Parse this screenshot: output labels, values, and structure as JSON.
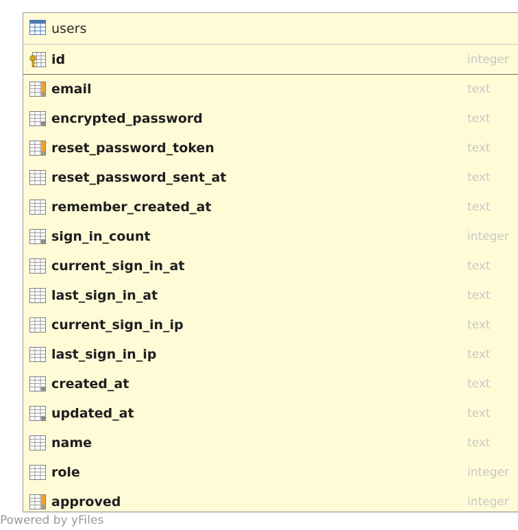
{
  "table": {
    "title": "users",
    "primary_key": {
      "name": "id",
      "type": "integer",
      "icon": "primary-key-column-icon"
    },
    "columns": [
      {
        "name": "email",
        "type": "text",
        "icon": "indexed-column-icon"
      },
      {
        "name": "encrypted_password",
        "type": "text",
        "icon": "nullable-column-icon"
      },
      {
        "name": "reset_password_token",
        "type": "text",
        "icon": "indexed-column-icon"
      },
      {
        "name": "reset_password_sent_at",
        "type": "text",
        "icon": "column-icon"
      },
      {
        "name": "remember_created_at",
        "type": "text",
        "icon": "column-icon"
      },
      {
        "name": "sign_in_count",
        "type": "integer",
        "icon": "nullable-column-icon"
      },
      {
        "name": "current_sign_in_at",
        "type": "text",
        "icon": "column-icon"
      },
      {
        "name": "last_sign_in_at",
        "type": "text",
        "icon": "column-icon"
      },
      {
        "name": "current_sign_in_ip",
        "type": "text",
        "icon": "column-icon"
      },
      {
        "name": "last_sign_in_ip",
        "type": "text",
        "icon": "column-icon"
      },
      {
        "name": "created_at",
        "type": "text",
        "icon": "nullable-column-icon"
      },
      {
        "name": "updated_at",
        "type": "text",
        "icon": "nullable-column-icon"
      },
      {
        "name": "name",
        "type": "text",
        "icon": "column-icon"
      },
      {
        "name": "role",
        "type": "integer",
        "icon": "column-icon"
      },
      {
        "name": "approved",
        "type": "integer",
        "icon": "indexed-column-icon"
      }
    ]
  },
  "footer": {
    "watermark": "Powered by yFiles"
  },
  "colors": {
    "node_fill": "#fffbd7",
    "node_border": "#9c9c9c",
    "type_text": "#c8c8c8",
    "index_accent": "#f0a030",
    "key_gold": "#d7a81c"
  }
}
